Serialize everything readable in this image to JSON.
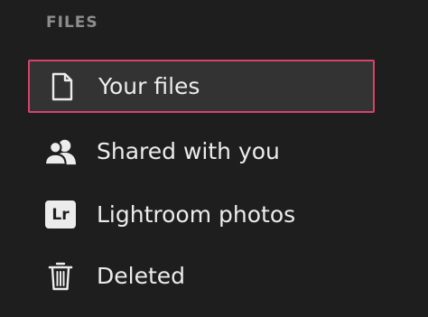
{
  "section": {
    "heading": "FILES"
  },
  "nav": {
    "items": [
      {
        "label": "Your files",
        "icon": "file-icon",
        "selected": true
      },
      {
        "label": "Shared with you",
        "icon": "people-icon",
        "selected": false
      },
      {
        "label": "Lightroom photos",
        "icon": "lightroom-icon",
        "badge": "Lr",
        "selected": false
      },
      {
        "label": "Deleted",
        "icon": "trash-icon",
        "selected": false
      }
    ]
  },
  "colors": {
    "background": "#1e1e1e",
    "selected_background": "#333333",
    "selected_border": "#d9416a",
    "heading": "#8d8d8d",
    "label": "#ececec"
  }
}
